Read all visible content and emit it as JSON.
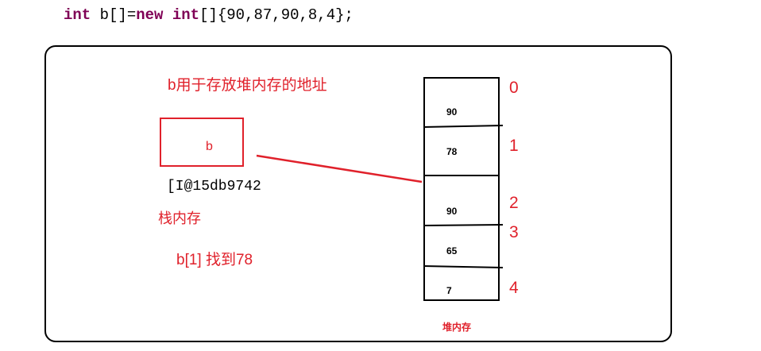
{
  "code_line": {
    "kw_int": "int",
    "var_decl": " b[]=",
    "kw_new": "new",
    "space": " ",
    "kw_int2": "int",
    "rest": "[]{90,87,90,8,4};"
  },
  "heap_note": "b用于存放堆内存的地址",
  "stack": {
    "box_label": "b",
    "address": "[I@15db9742",
    "label": "栈内存"
  },
  "access_note": "b[1] 找到78",
  "heap": {
    "cells": [
      "90",
      "78",
      "90",
      "65",
      "7"
    ],
    "indices": [
      "0",
      "1",
      "2",
      "3",
      "4"
    ],
    "label": "堆内存"
  },
  "colors": {
    "annotation": "#e0212b",
    "keyword": "#7f0055"
  }
}
